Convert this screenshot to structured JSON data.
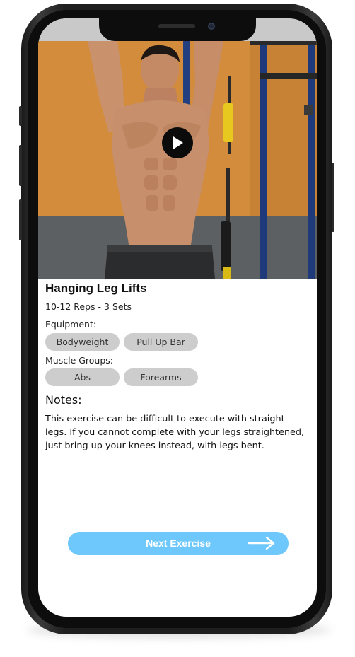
{
  "exercise": {
    "title": "Hanging Leg Lifts",
    "reps_sets": "10-12 Reps - 3 Sets"
  },
  "equipment": {
    "label": "Equipment:",
    "items": [
      "Bodyweight",
      "Pull Up Bar"
    ]
  },
  "muscle_groups": {
    "label": "Muscle Groups:",
    "items": [
      "Abs",
      "Forearms"
    ]
  },
  "notes": {
    "heading": "Notes:",
    "body": "This exercise can be difficult to execute with straight legs. If you cannot complete with your legs straightened, just bring up your knees instead, with legs bent."
  },
  "next_button": {
    "label": "Next Exercise",
    "color": "#6ec8fb"
  },
  "icons": {
    "play": "play-icon",
    "next": "arrow-right-icon"
  }
}
